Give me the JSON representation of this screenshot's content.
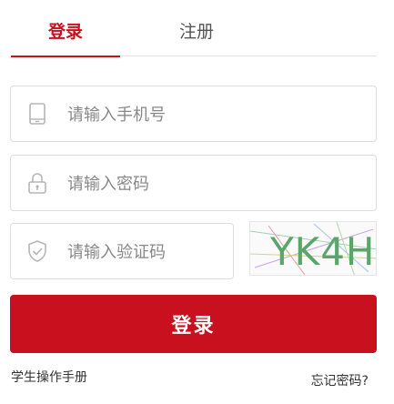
{
  "tabs": {
    "login": "登录",
    "register": "注册"
  },
  "fields": {
    "phone": {
      "placeholder": "请输入手机号",
      "value": ""
    },
    "password": {
      "placeholder": "请输入密码",
      "value": ""
    },
    "code": {
      "placeholder": "请输入验证码",
      "value": ""
    }
  },
  "captcha": {
    "text": "YK4H"
  },
  "login_button": "登录",
  "links": {
    "manual": "学生操作手册",
    "forgot": "忘记密码?"
  },
  "colors": {
    "accent": "#c8101e",
    "border": "#dcdcdc",
    "icon": "#b5b5b5"
  },
  "icons": {
    "phone": "phone-icon",
    "password": "lock-icon",
    "code": "shield-check-icon"
  }
}
